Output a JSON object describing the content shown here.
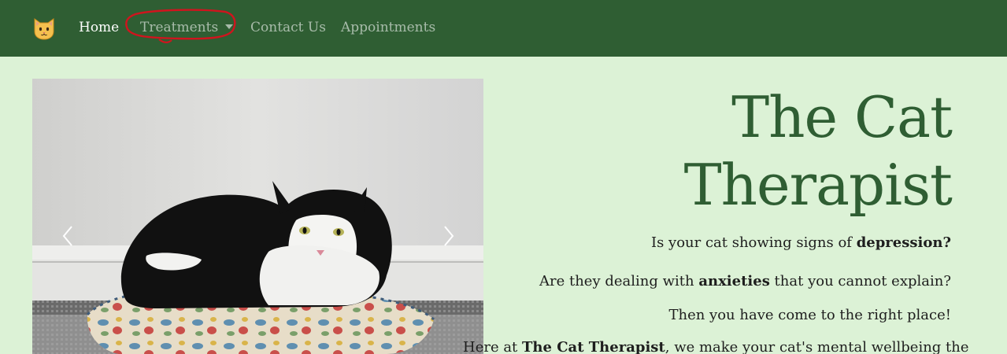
{
  "nav": {
    "brand_icon": "cat-face-icon",
    "items": [
      {
        "label": "Home",
        "active": true
      },
      {
        "label": "Treatments",
        "dropdown": true
      },
      {
        "label": "Contact Us"
      },
      {
        "label": "Appointments"
      }
    ]
  },
  "carousel": {
    "image_description_icon": "cat-photo",
    "prev_icon": "chevron-left-icon",
    "next_icon": "chevron-right-icon"
  },
  "hero": {
    "title_line1": "The Cat",
    "title_line2": "Therapist",
    "p1_pre": "Is your cat showing signs of ",
    "p1_bold": "depression?",
    "p2_pre": "Are they dealing with ",
    "p2_bold": "anxieties",
    "p2_post": " that you cannot explain?",
    "p3": "Then you have come to the right place!",
    "p4_pre": "Here at ",
    "p4_bold": "The Cat Therapist",
    "p4_post": ", we make your cat's mental wellbeing the"
  },
  "colors": {
    "navbar": "#2f5e33",
    "background": "#dcf2d6",
    "title": "#2f5e33",
    "annotation": "#d0141e"
  }
}
